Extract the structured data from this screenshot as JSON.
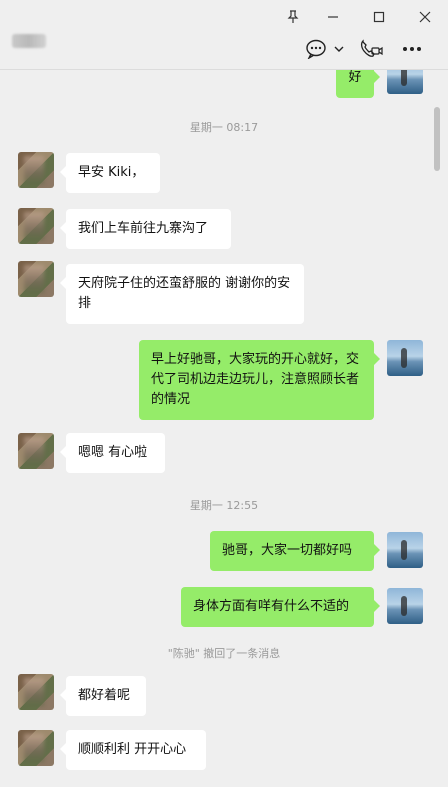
{
  "window": {
    "controls": [
      "pin-icon",
      "minimize-icon",
      "maximize-icon",
      "close-icon"
    ]
  },
  "header": {
    "icons": [
      "chat-bubble-icon",
      "chevron-down-icon",
      "video-call-icon",
      "more-icon"
    ]
  },
  "messages": [
    {
      "type": "out",
      "text": "好"
    },
    {
      "type": "time",
      "text": "星期一 08:17"
    },
    {
      "type": "in",
      "text": "早安 Kiki，"
    },
    {
      "type": "in",
      "text": "我们上车前往九寨沟了"
    },
    {
      "type": "in",
      "text": "天府院子住的还蛮舒服的 谢谢你的安排"
    },
    {
      "type": "out",
      "text": "早上好驰哥，大家玩的开心就好，交代了司机边走边玩儿，注意照顾长者的情况"
    },
    {
      "type": "in",
      "text": "嗯嗯 有心啦"
    },
    {
      "type": "time",
      "text": "星期一 12:55"
    },
    {
      "type": "out",
      "text": "驰哥，大家一切都好吗"
    },
    {
      "type": "out",
      "text": "身体方面有咩有什么不适的"
    },
    {
      "type": "recall",
      "text": "\"陈驰\" 撤回了一条消息"
    },
    {
      "type": "in",
      "text": "都好着呢"
    },
    {
      "type": "in",
      "text": "顺顺利利 开开心心"
    }
  ],
  "colors": {
    "background": "#efefef",
    "self_bubble": "#95ec69",
    "friend_bubble": "#ffffff",
    "meta_text": "#9a9a9a"
  }
}
